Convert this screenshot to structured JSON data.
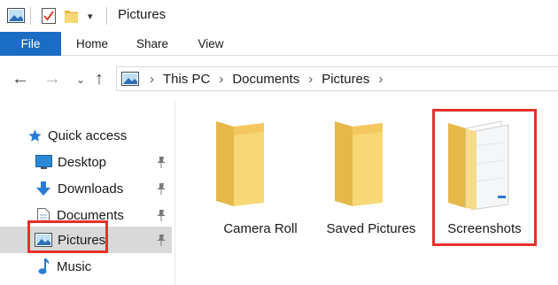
{
  "window": {
    "title": "Pictures"
  },
  "ribbon": {
    "tabs": [
      {
        "label": "File"
      },
      {
        "label": "Home"
      },
      {
        "label": "Share"
      },
      {
        "label": "View"
      }
    ]
  },
  "address": {
    "crumbs": [
      "This PC",
      "Documents",
      "Pictures"
    ]
  },
  "sidebar": {
    "quick_access": "Quick access",
    "items": [
      {
        "label": "Desktop",
        "icon": "desktop-icon",
        "pinned": true
      },
      {
        "label": "Downloads",
        "icon": "download-icon",
        "pinned": true
      },
      {
        "label": "Documents",
        "icon": "documents-icon",
        "pinned": true
      },
      {
        "label": "Pictures",
        "icon": "pictures-icon",
        "pinned": true,
        "selected": true
      },
      {
        "label": "Music",
        "icon": "music-icon",
        "pinned": false
      }
    ]
  },
  "folders": [
    {
      "label": "Camera Roll",
      "icon": "folder-icon"
    },
    {
      "label": "Saved Pictures",
      "icon": "folder-icon"
    },
    {
      "label": "Screenshots",
      "icon": "folder-with-files-icon",
      "highlighted": true
    }
  ],
  "colors": {
    "file_tab": "#1a6cc4",
    "highlight": "#e8302a",
    "folder": "#f8d775",
    "selection": "#d9d9d9"
  }
}
